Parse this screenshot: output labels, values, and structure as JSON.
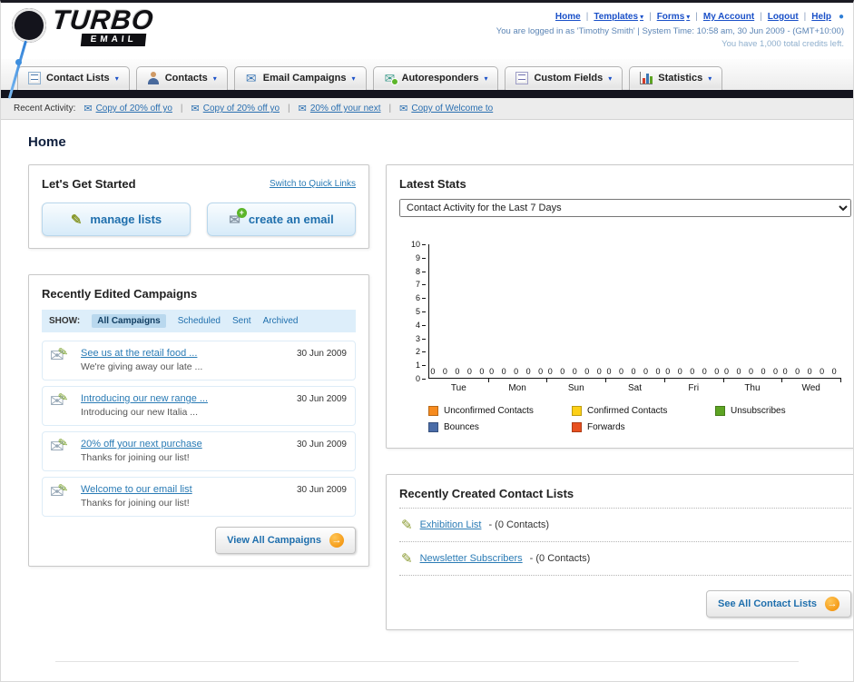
{
  "icons": {
    "chevron_down": "▾",
    "envelope": "✉",
    "pencil": "✎",
    "arrow_right": "→",
    "plus": "+",
    "dot": "●",
    "pipe": "|"
  },
  "header": {
    "logo_main": "TURBO",
    "logo_sub": "EMAIL",
    "top_links": [
      {
        "label": "Home"
      },
      {
        "label": "Templates"
      },
      {
        "label": "Forms"
      },
      {
        "label": "My Account"
      },
      {
        "label": "Logout"
      },
      {
        "label": "Help"
      }
    ],
    "login_info": "You are logged in as 'Timothy Smith' | System Time: 10:58 am, 30 Jun 2009 - (GMT+10:00)",
    "credits": "You have 1,000 total credits left."
  },
  "main_nav": [
    {
      "label": "Contact Lists"
    },
    {
      "label": "Contacts"
    },
    {
      "label": "Email Campaigns"
    },
    {
      "label": "Autoresponders"
    },
    {
      "label": "Custom Fields"
    },
    {
      "label": "Statistics"
    }
  ],
  "recent_activity": {
    "label": "Recent Activity:",
    "items": [
      {
        "label": "Copy of 20% off yo"
      },
      {
        "label": "Copy of 20% off yo"
      },
      {
        "label": "20% off your next"
      },
      {
        "label": "Copy of Welcome to"
      }
    ]
  },
  "page_title": "Home",
  "get_started": {
    "title": "Let's Get Started",
    "switch_link": "Switch to Quick Links",
    "manage_lists_label": "manage lists",
    "create_email_label": "create an email"
  },
  "campaigns": {
    "title": "Recently Edited Campaigns",
    "show_label": "SHOW:",
    "tabs": [
      {
        "label": "All Campaigns"
      },
      {
        "label": "Scheduled"
      },
      {
        "label": "Sent"
      },
      {
        "label": "Archived"
      }
    ],
    "items": [
      {
        "title": "See us at the retail food ...",
        "subtitle": "We're giving away our late ...",
        "date": "30 Jun 2009"
      },
      {
        "title": "Introducing our new range ...",
        "subtitle": "Introducing our new Italia ...",
        "date": "30 Jun 2009"
      },
      {
        "title": "20% off your next purchase",
        "subtitle": "Thanks for joining our list!",
        "date": "30 Jun 2009"
      },
      {
        "title": "Welcome to our email list",
        "subtitle": "Thanks for joining our list!",
        "date": "30 Jun 2009"
      }
    ],
    "view_all_label": "View All Campaigns"
  },
  "latest_stats": {
    "title": "Latest Stats",
    "range_selected": "Contact Activity for the Last 7 Days"
  },
  "chart_data": {
    "type": "bar",
    "title": "Contact Activity for the Last 7 Days",
    "categories": [
      "Tue",
      "Mon",
      "Sun",
      "Sat",
      "Fri",
      "Thu",
      "Wed"
    ],
    "series": [
      {
        "name": "Unconfirmed Contacts",
        "color": "#f68b1f",
        "values": [
          0,
          0,
          0,
          0,
          0,
          0,
          0
        ]
      },
      {
        "name": "Confirmed Contacts",
        "color": "#fdd017",
        "values": [
          0,
          0,
          0,
          0,
          0,
          0,
          0
        ]
      },
      {
        "name": "Unsubscribes",
        "color": "#5da423",
        "values": [
          0,
          0,
          0,
          0,
          0,
          0,
          0
        ]
      },
      {
        "name": "Bounces",
        "color": "#4a6ca8",
        "values": [
          0,
          0,
          0,
          0,
          0,
          0,
          0
        ]
      },
      {
        "name": "Forwards",
        "color": "#e8501f",
        "values": [
          0,
          0,
          0,
          0,
          0,
          0,
          0
        ]
      }
    ],
    "ylim": [
      0,
      10
    ],
    "xlabel": "",
    "ylabel": "",
    "grid": false,
    "legend_position": "bottom"
  },
  "contact_lists": {
    "title": "Recently Created Contact Lists",
    "items": [
      {
        "name": "Exhibition List",
        "detail": "- (0 Contacts)"
      },
      {
        "name": "Newsletter Subscribers",
        "detail": "- (0 Contacts)"
      }
    ],
    "see_all_label": "See All Contact Lists"
  }
}
